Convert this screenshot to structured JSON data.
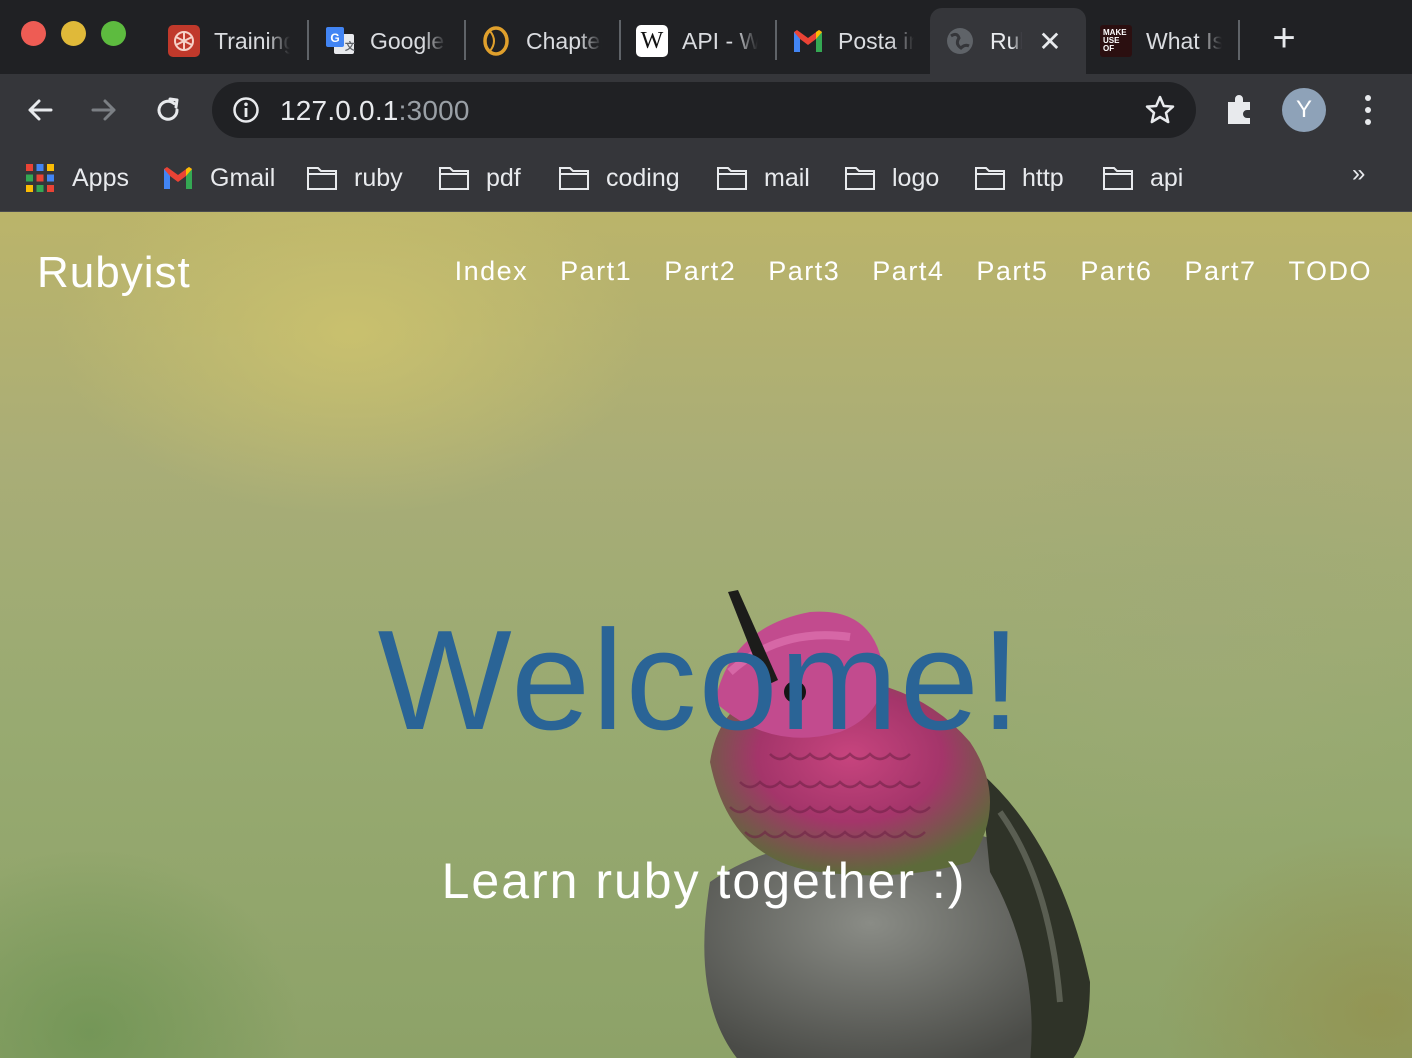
{
  "browser": {
    "tabs": [
      {
        "label": "Training",
        "favicon": "openai-icon"
      },
      {
        "label": "Google Translate",
        "favicon": "google-translate-icon"
      },
      {
        "label": "Chapter",
        "favicon": "chapter-icon"
      },
      {
        "label": "API - Wikipedia",
        "favicon": "wikipedia-icon"
      },
      {
        "label": "Posta in arrivo",
        "favicon": "gmail-icon"
      },
      {
        "label": "Rubyist",
        "favicon": "globe-icon",
        "active": true
      },
      {
        "label": "What Is",
        "favicon": "makeuseof-icon"
      }
    ],
    "close_glyph": "✕",
    "new_tab_glyph": "+",
    "url_host": "127.0.0.1",
    "url_port": ":3000",
    "profile_initial": "Y",
    "bookmarks": [
      {
        "label": "Apps",
        "icon": "apps-grid-icon"
      },
      {
        "label": "Gmail",
        "icon": "gmail-icon"
      },
      {
        "label": "ruby",
        "icon": "folder-icon"
      },
      {
        "label": "pdf",
        "icon": "folder-icon"
      },
      {
        "label": "coding",
        "icon": "folder-icon"
      },
      {
        "label": "mail",
        "icon": "folder-icon"
      },
      {
        "label": "logo",
        "icon": "folder-icon"
      },
      {
        "label": "http",
        "icon": "folder-icon"
      },
      {
        "label": "api",
        "icon": "folder-icon"
      }
    ],
    "bookmarks_more": "»"
  },
  "site": {
    "brand": "Rubyist",
    "nav": [
      "Index",
      "Part1",
      "Part2",
      "Part3",
      "Part4",
      "Part5",
      "Part6",
      "Part7",
      "TODO"
    ],
    "hero_title": "Welcome!",
    "hero_subtitle": "Learn ruby together :)"
  },
  "colors": {
    "chrome_dark": "#202124",
    "chrome_toolbar": "#35363a",
    "hero_title": "#2a6496",
    "nav_text": "#ffffff"
  }
}
